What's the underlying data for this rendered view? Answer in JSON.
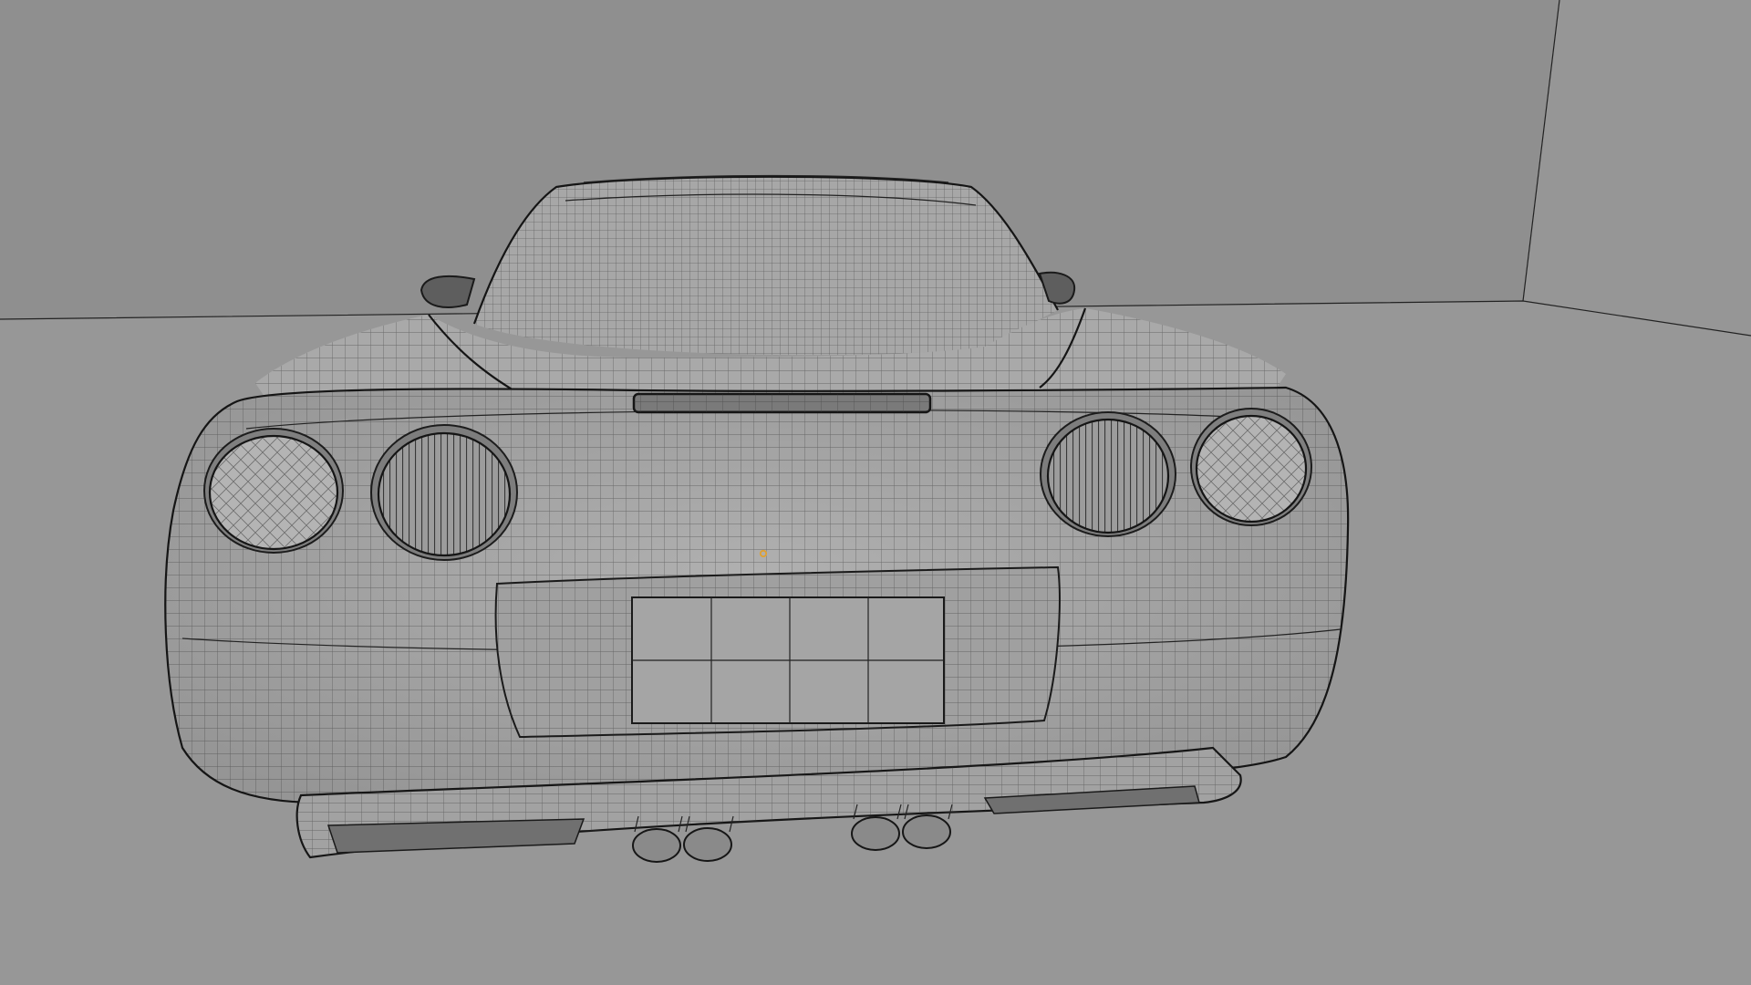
{
  "viewport": {
    "mode": "wireframe-overlay",
    "background_color": "#8e8e8e",
    "floor_color": "#979797",
    "wall_color": "#8f8f8f",
    "mesh_color": "#a3a3a3",
    "wire_color": "#2a2a2a",
    "origin_color": "#e0a030"
  },
  "scene": {
    "object": "car-model",
    "view": "rear"
  }
}
